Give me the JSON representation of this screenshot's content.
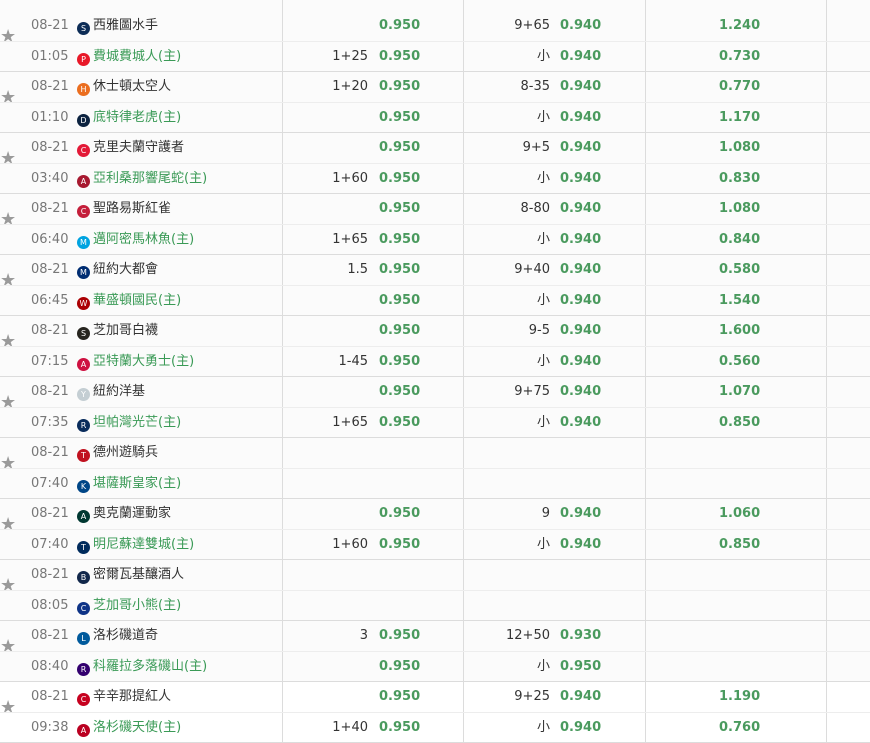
{
  "matches": [
    {
      "date": "08-21",
      "time": "01:05",
      "away": {
        "name": "西雅圖水手",
        "logo": "S",
        "color": "#0c2c56"
      },
      "home": {
        "name": "費城費城人(主)",
        "logo": "P",
        "color": "#e81828"
      },
      "rl_away_line": "",
      "rl_away_odds": "0.950",
      "rl_home_line": "1+25",
      "rl_home_odds": "0.950",
      "ou_top_line": "9+65",
      "ou_top_odds": "0.940",
      "ou_bot_line": "小",
      "ou_bot_odds": "0.940",
      "ml_away": "1.240",
      "ml_home": "0.730"
    },
    {
      "date": "08-21",
      "time": "01:10",
      "away": {
        "name": "休士頓太空人",
        "logo": "H",
        "color": "#eb6e1f"
      },
      "home": {
        "name": "底特律老虎(主)",
        "logo": "D",
        "color": "#0c2340"
      },
      "rl_away_line": "1+20",
      "rl_away_odds": "0.950",
      "rl_home_line": "",
      "rl_home_odds": "0.950",
      "ou_top_line": "8-35",
      "ou_top_odds": "0.940",
      "ou_bot_line": "小",
      "ou_bot_odds": "0.940",
      "ml_away": "0.770",
      "ml_home": "1.170"
    },
    {
      "date": "08-21",
      "time": "03:40",
      "away": {
        "name": "克里夫蘭守護者",
        "logo": "C",
        "color": "#e31937"
      },
      "home": {
        "name": "亞利桑那響尾蛇(主)",
        "logo": "A",
        "color": "#a71930"
      },
      "rl_away_line": "",
      "rl_away_odds": "0.950",
      "rl_home_line": "1+60",
      "rl_home_odds": "0.950",
      "ou_top_line": "9+5",
      "ou_top_odds": "0.940",
      "ou_bot_line": "小",
      "ou_bot_odds": "0.940",
      "ml_away": "1.080",
      "ml_home": "0.830"
    },
    {
      "date": "08-21",
      "time": "06:40",
      "away": {
        "name": "聖路易斯紅雀",
        "logo": "C",
        "color": "#c41e3a"
      },
      "home": {
        "name": "邁阿密馬林魚(主)",
        "logo": "M",
        "color": "#00a3e0"
      },
      "rl_away_line": "",
      "rl_away_odds": "0.950",
      "rl_home_line": "1+65",
      "rl_home_odds": "0.950",
      "ou_top_line": "8-80",
      "ou_top_odds": "0.940",
      "ou_bot_line": "小",
      "ou_bot_odds": "0.940",
      "ml_away": "1.080",
      "ml_home": "0.840"
    },
    {
      "date": "08-21",
      "time": "06:45",
      "away": {
        "name": "紐約大都會",
        "logo": "M",
        "color": "#002d72"
      },
      "home": {
        "name": "華盛頓國民(主)",
        "logo": "W",
        "color": "#ab0003"
      },
      "rl_away_line": "1.5",
      "rl_away_odds": "0.950",
      "rl_home_line": "",
      "rl_home_odds": "0.950",
      "ou_top_line": "9+40",
      "ou_top_odds": "0.940",
      "ou_bot_line": "小",
      "ou_bot_odds": "0.940",
      "ml_away": "0.580",
      "ml_home": "1.540"
    },
    {
      "date": "08-21",
      "time": "07:15",
      "away": {
        "name": "芝加哥白襪",
        "logo": "S",
        "color": "#27251f"
      },
      "home": {
        "name": "亞特蘭大勇士(主)",
        "logo": "A",
        "color": "#ce1141"
      },
      "rl_away_line": "",
      "rl_away_odds": "0.950",
      "rl_home_line": "1-45",
      "rl_home_odds": "0.950",
      "ou_top_line": "9-5",
      "ou_top_odds": "0.940",
      "ou_bot_line": "小",
      "ou_bot_odds": "0.940",
      "ml_away": "1.600",
      "ml_home": "0.560"
    },
    {
      "date": "08-21",
      "time": "07:35",
      "away": {
        "name": "紐約洋基",
        "logo": "Y",
        "color": "#c4ced3"
      },
      "home": {
        "name": "坦帕灣光芒(主)",
        "logo": "R",
        "color": "#092c5c"
      },
      "rl_away_line": "",
      "rl_away_odds": "0.950",
      "rl_home_line": "1+65",
      "rl_home_odds": "0.950",
      "ou_top_line": "9+75",
      "ou_top_odds": "0.940",
      "ou_bot_line": "小",
      "ou_bot_odds": "0.940",
      "ml_away": "1.070",
      "ml_home": "0.850"
    },
    {
      "date": "08-21",
      "time": "07:40",
      "away": {
        "name": "德州遊騎兵",
        "logo": "T",
        "color": "#c0111f"
      },
      "home": {
        "name": "堪薩斯皇家(主)",
        "logo": "K",
        "color": "#004687"
      },
      "rl_away_line": "",
      "rl_away_odds": "",
      "rl_home_line": "",
      "rl_home_odds": "",
      "ou_top_line": "",
      "ou_top_odds": "",
      "ou_bot_line": "",
      "ou_bot_odds": "",
      "ml_away": "",
      "ml_home": ""
    },
    {
      "date": "08-21",
      "time": "07:40",
      "away": {
        "name": "奧克蘭運動家",
        "logo": "A",
        "color": "#003831"
      },
      "home": {
        "name": "明尼蘇達雙城(主)",
        "logo": "T",
        "color": "#002b5c"
      },
      "rl_away_line": "",
      "rl_away_odds": "0.950",
      "rl_home_line": "1+60",
      "rl_home_odds": "0.950",
      "ou_top_line": "9",
      "ou_top_odds": "0.940",
      "ou_bot_line": "小",
      "ou_bot_odds": "0.940",
      "ml_away": "1.060",
      "ml_home": "0.850"
    },
    {
      "date": "08-21",
      "time": "08:05",
      "away": {
        "name": "密爾瓦基釀酒人",
        "logo": "B",
        "color": "#12284b"
      },
      "home": {
        "name": "芝加哥小熊(主)",
        "logo": "C",
        "color": "#0e3386"
      },
      "rl_away_line": "",
      "rl_away_odds": "",
      "rl_home_line": "",
      "rl_home_odds": "",
      "ou_top_line": "",
      "ou_top_odds": "",
      "ou_bot_line": "",
      "ou_bot_odds": "",
      "ml_away": "",
      "ml_home": ""
    },
    {
      "date": "08-21",
      "time": "08:40",
      "away": {
        "name": "洛杉磯道奇",
        "logo": "L",
        "color": "#005a9c"
      },
      "home": {
        "name": "科羅拉多落磯山(主)",
        "logo": "R",
        "color": "#33006f"
      },
      "rl_away_line": "3",
      "rl_away_odds": "0.950",
      "rl_home_line": "",
      "rl_home_odds": "0.950",
      "ou_top_line": "12+50",
      "ou_top_odds": "0.930",
      "ou_bot_line": "小",
      "ou_bot_odds": "0.950",
      "ml_away": "",
      "ml_home": ""
    },
    {
      "date": "08-21",
      "time": "09:38",
      "away": {
        "name": "辛辛那提紅人",
        "logo": "C",
        "color": "#c6011f"
      },
      "home": {
        "name": "洛杉磯天使(主)",
        "logo": "A",
        "color": "#ba0021"
      },
      "rl_away_line": "",
      "rl_away_odds": "0.950",
      "rl_home_line": "1+40",
      "rl_home_odds": "0.950",
      "ou_top_line": "9+25",
      "ou_top_odds": "0.940",
      "ou_bot_line": "小",
      "ou_bot_odds": "0.940",
      "ml_away": "1.190",
      "ml_home": "0.760"
    }
  ],
  "star_icon": "★"
}
